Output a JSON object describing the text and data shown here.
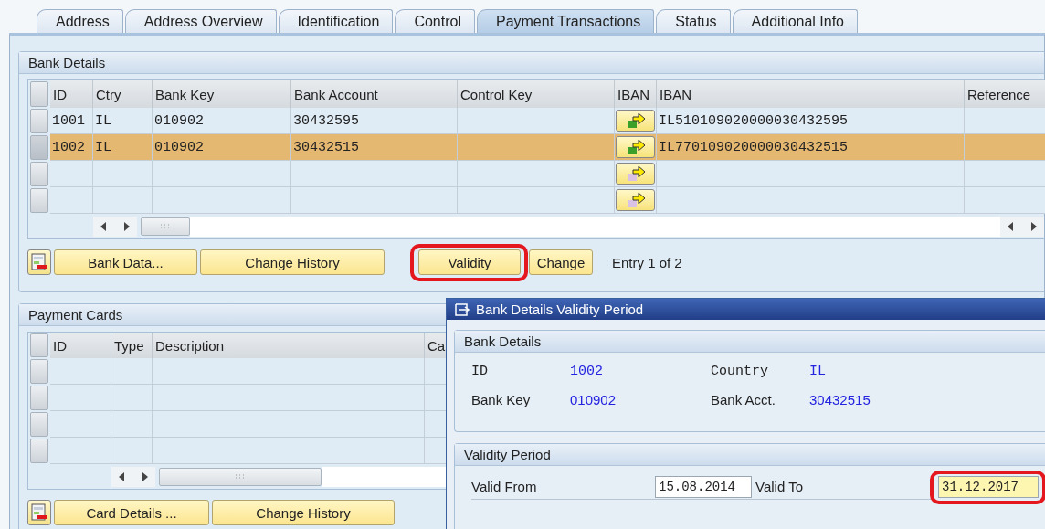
{
  "tabs": [
    {
      "label": "Address",
      "selected": false
    },
    {
      "label": "Address Overview",
      "selected": false
    },
    {
      "label": "Identification",
      "selected": false
    },
    {
      "label": "Control",
      "selected": false
    },
    {
      "label": "Payment Transactions",
      "selected": true
    },
    {
      "label": "Status",
      "selected": false
    },
    {
      "label": "Additional Info",
      "selected": false
    }
  ],
  "bank_details": {
    "title": "Bank Details",
    "columns": [
      "ID",
      "Ctry",
      "Bank Key",
      "Bank Account",
      "Control Key",
      "IBAN",
      "IBAN",
      "Reference"
    ],
    "rows": [
      {
        "id": "1001",
        "country": "IL",
        "bank_key": "010902",
        "bank_account": "30432595",
        "iban": "IL510109020000030432595",
        "selected": false,
        "has_iban": true
      },
      {
        "id": "1002",
        "country": "IL",
        "bank_key": "010902",
        "bank_account": "30432515",
        "iban": "IL770109020000030432515",
        "selected": true,
        "has_iban": true
      },
      {
        "selected": false,
        "has_iban": false
      },
      {
        "selected": false,
        "has_iban": false
      }
    ],
    "buttons": [
      {
        "label": "Bank Data...",
        "highlighted": false
      },
      {
        "label": "Change History",
        "highlighted": false
      },
      {
        "label": "Validity",
        "highlighted": true
      },
      {
        "label": "Change",
        "highlighted": false
      }
    ],
    "entry_status": "Entry 1 of 2"
  },
  "payment_cards": {
    "title": "Payment Cards",
    "columns": [
      "ID",
      "Type",
      "Description",
      "Ca"
    ],
    "rows": [
      {
        "selected": false
      },
      {
        "selected": false
      },
      {
        "selected": false
      },
      {
        "selected": false
      }
    ],
    "buttons": [
      {
        "label": "Card Details ..."
      },
      {
        "label": "Change History"
      }
    ]
  },
  "dialog": {
    "title": "Bank Details Validity Period",
    "bank_details": {
      "title": "Bank Details",
      "fields": [
        {
          "label": "ID",
          "value": "1002",
          "kind": "code"
        },
        {
          "label": "Country",
          "value": "IL",
          "kind": "code"
        },
        {
          "label": "Bank Key",
          "value": "010902",
          "kind": "text"
        },
        {
          "label": "Bank Acct.",
          "value": "30432515",
          "kind": "text"
        }
      ]
    },
    "validity_period": {
      "title": "Validity Period",
      "valid_from": {
        "label": "Valid From",
        "value": "15.08.2014",
        "highlighted": false
      },
      "valid_to": {
        "label": "Valid To",
        "value": "31.12.2017",
        "highlighted": true
      }
    }
  }
}
